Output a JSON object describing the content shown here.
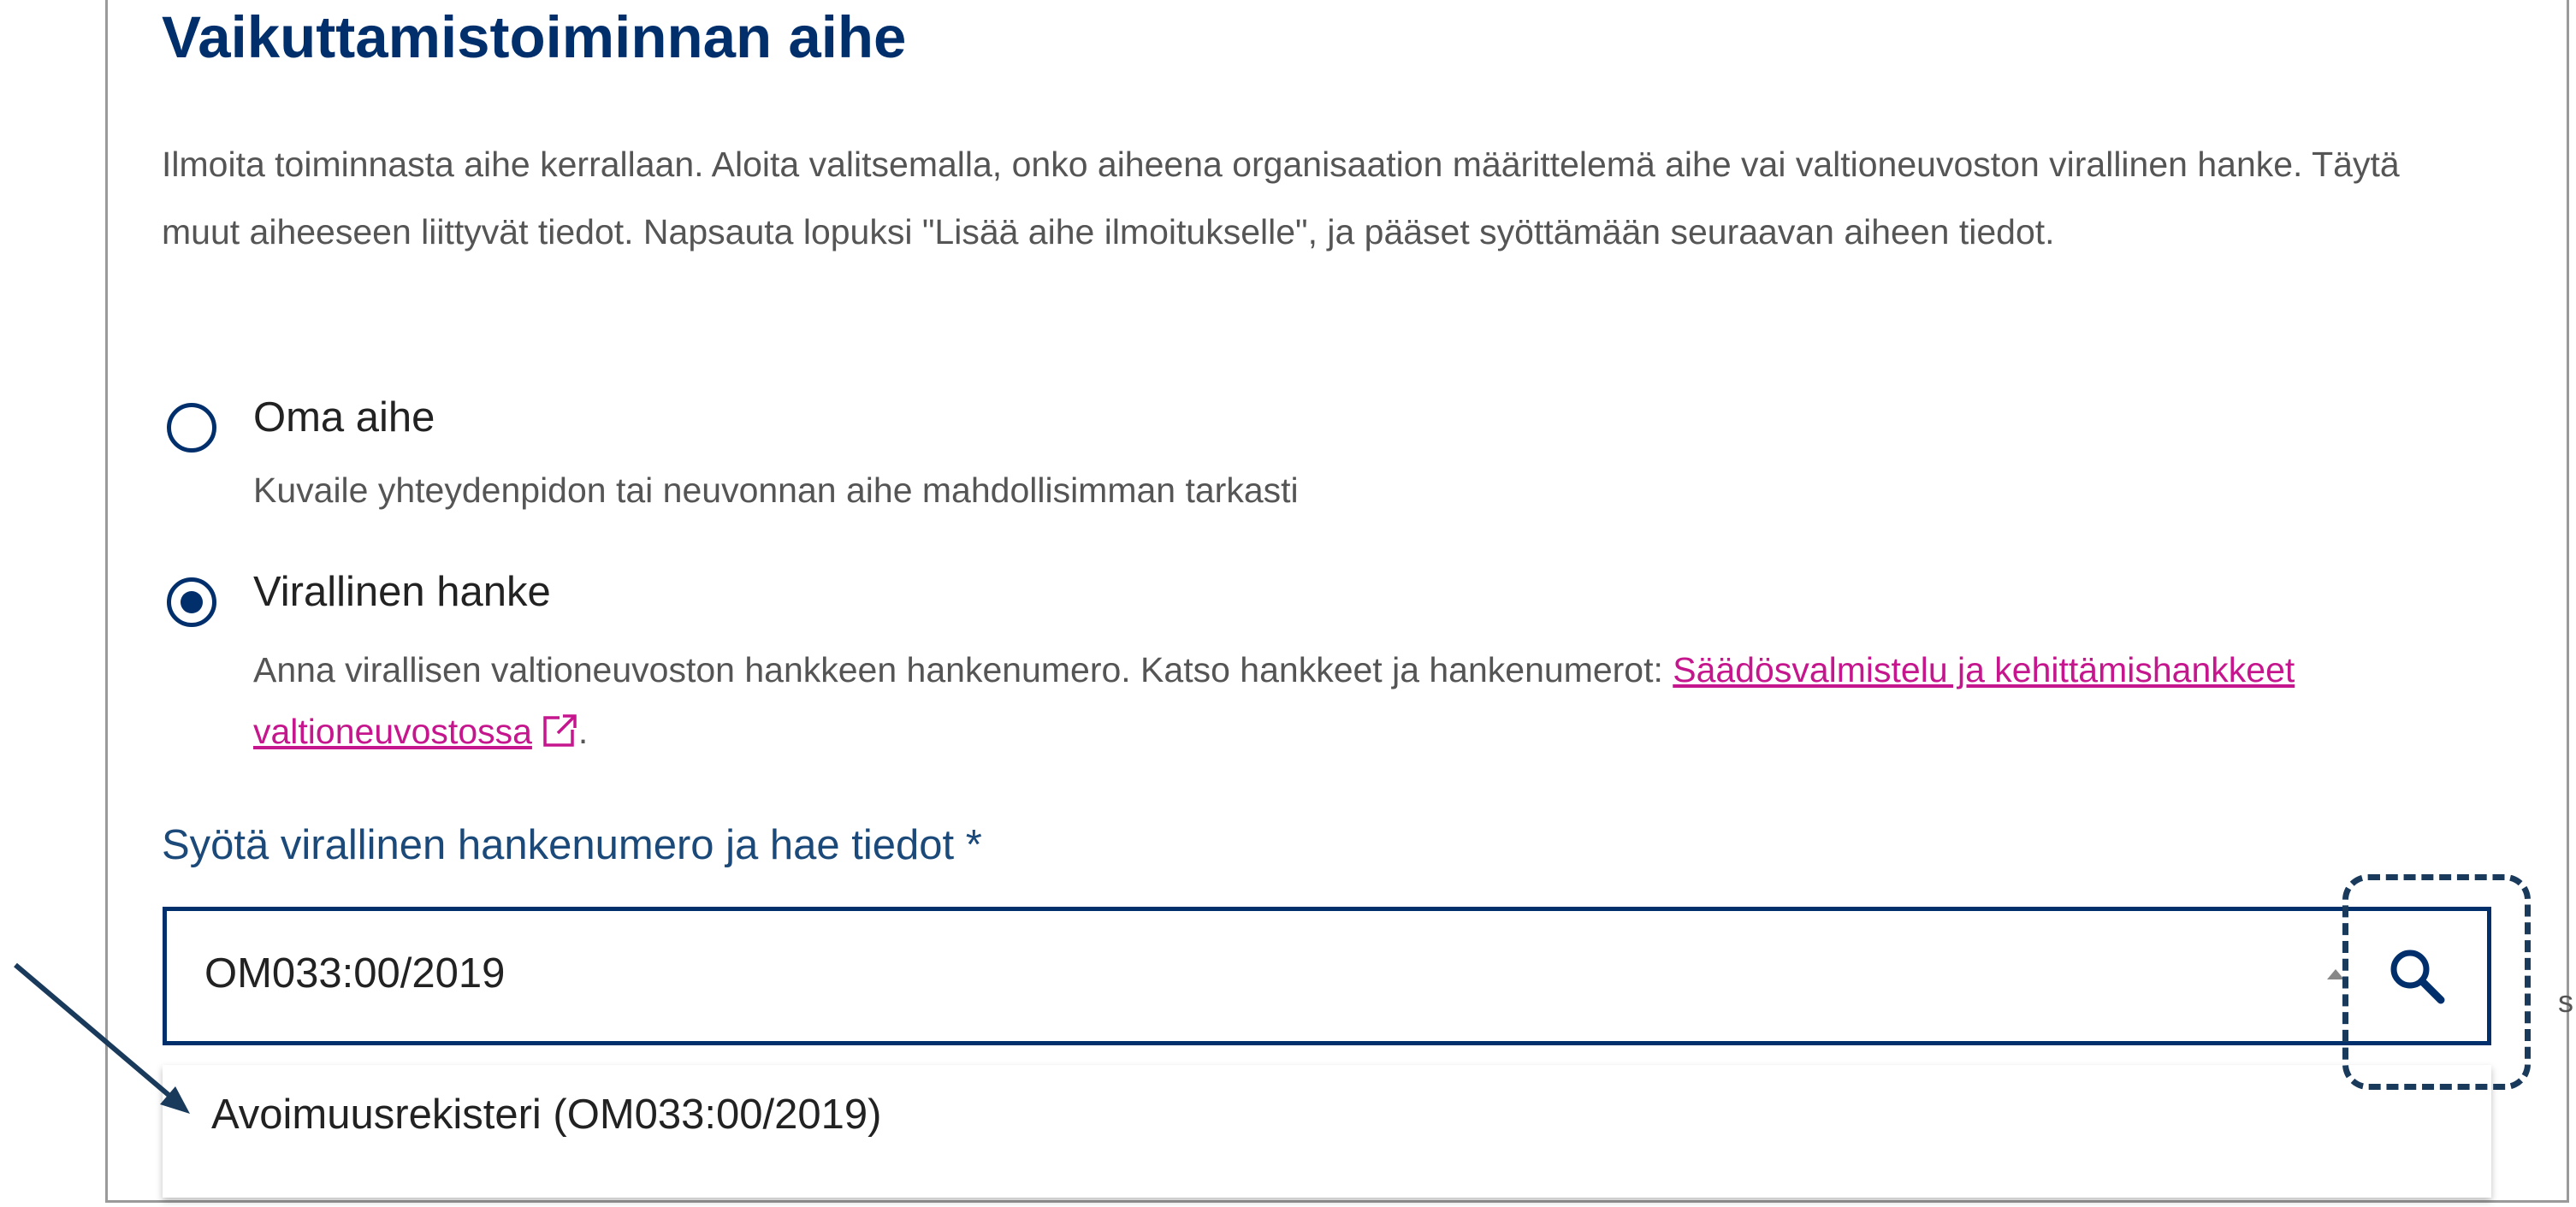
{
  "section": {
    "title": "Vaikuttamistoiminnan aihe",
    "intro": "Ilmoita toiminnasta aihe kerrallaan. Aloita valitsemalla, onko aiheena organisaation määrittelemä aihe vai valtioneuvoston virallinen hanke. Täytä muut aiheeseen liittyvät tiedot. Napsauta lopuksi \"Lisää aihe ilmoitukselle\", ja pääset syöttämään seuraavan aiheen tiedot."
  },
  "options": [
    {
      "label": "Oma aihe",
      "hint": "Kuvaile yhteydenpidon tai neuvonnan aihe mahdollisimman tarkasti",
      "selected": false
    },
    {
      "label": "Virallinen hanke",
      "hint": "Anna virallisen valtioneuvoston hankkeen hankenumero. Katso hankkeet ja hankenumerot: ",
      "link_text": "Säädösvalmistelu ja kehittämishankkeet valtioneuvostossa",
      "hint_suffix": ".",
      "selected": true
    }
  ],
  "search": {
    "label": "Syötä virallinen hankenumero ja hae tiedot *",
    "value": "OM033:00/2019",
    "icon": "search-icon"
  },
  "dropdown": {
    "items": [
      "Avoimuusrekisteri (OM033:00/2019)"
    ]
  },
  "colors": {
    "heading": "#002f6c",
    "link": "#c6168d",
    "radio": "#002f6c",
    "annotation": "#1a3a5c"
  }
}
